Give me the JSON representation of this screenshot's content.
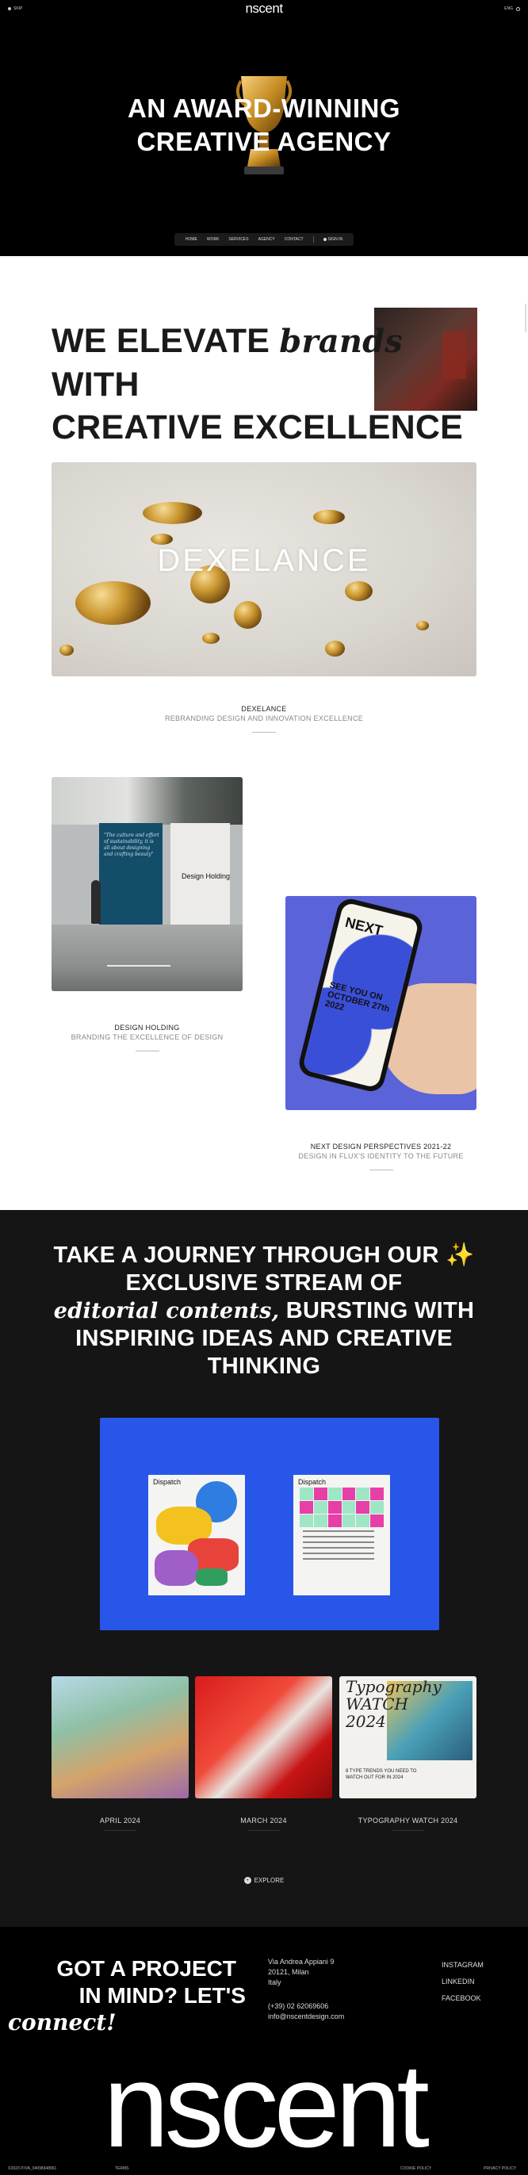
{
  "header": {
    "left_label": "SKIP",
    "logo": "nscent",
    "right_label": "ENG"
  },
  "hero": {
    "title_line1": "AN AWARD-WINNING",
    "title_line2": "CREATIVE AGENCY"
  },
  "nav": {
    "items": [
      "HOME",
      "WORK",
      "SERVICES",
      "AGENCY",
      "CONTACT"
    ],
    "signin": "SIGN IN"
  },
  "elevate": {
    "line1_a": "WE ELEVATE ",
    "line1_em": "brands",
    "line1_b": " WITH",
    "line2": "CREATIVE EXCELLENCE"
  },
  "projects": [
    {
      "image_word": "DEXELANCE",
      "title": "DEXELANCE",
      "subtitle": "REBRANDING DESIGN AND INNOVATION EXCELLENCE"
    },
    {
      "image_word": "Design Holding",
      "panel_text": "\"The culture and effort of sustainability, it is all about designing and crafting beauty\"",
      "title": "DESIGN HOLDING",
      "subtitle": "BRANDING THE EXCELLENCE OF DESIGN"
    },
    {
      "phone_title": "NEXT",
      "phone_text": "SEE YOU ON OCTOBER 27th 2022",
      "title": "NEXT DESIGN PERSPECTIVES 2021-22",
      "subtitle": "DESIGN IN FLUX'S IDENTITY TO THE FUTURE"
    }
  ],
  "journey": {
    "line1": "TAKE A JOURNEY THROUGH OUR ✨",
    "line2": "EXCLUSIVE STREAM OF",
    "line3_em": "editorial contents,",
    "line3_b": " BURSTING WITH",
    "line4": "INSPIRING IDEAS AND CREATIVE",
    "line5": "THINKING"
  },
  "dispatch": {
    "mag1_title": "Dispatch",
    "mag2_title": "Dispatch"
  },
  "news": [
    {
      "title": "APRIL 2024"
    },
    {
      "title": "MARCH 2024"
    },
    {
      "title": "TYPOGRAPHY WATCH 2024",
      "card_title": "Typography WATCH 2024",
      "card_text": "8 TYPE TRENDS YOU NEED TO WATCH OUT FOR IN 2024"
    }
  ],
  "explore": {
    "label": "EXPLORE"
  },
  "footer": {
    "got_line1": "GOT A PROJECT",
    "got_line2": "IN MIND? LET'S",
    "got_line3": "connect!",
    "address": [
      "Via Andrea Appiani 9",
      "20121, Milan",
      "Italy"
    ],
    "phone": "(+39) 02 62069606",
    "email": "info@nscentdesign.com",
    "social": [
      "INSTAGRAM",
      "LINKEDIN",
      "FACEBOOK"
    ],
    "big_logo": "nscent",
    "legal": [
      "©2023 P.IVA_04098348961",
      "TERMS",
      "COOKIE POLICY",
      "PRIVACY POLICY"
    ]
  }
}
